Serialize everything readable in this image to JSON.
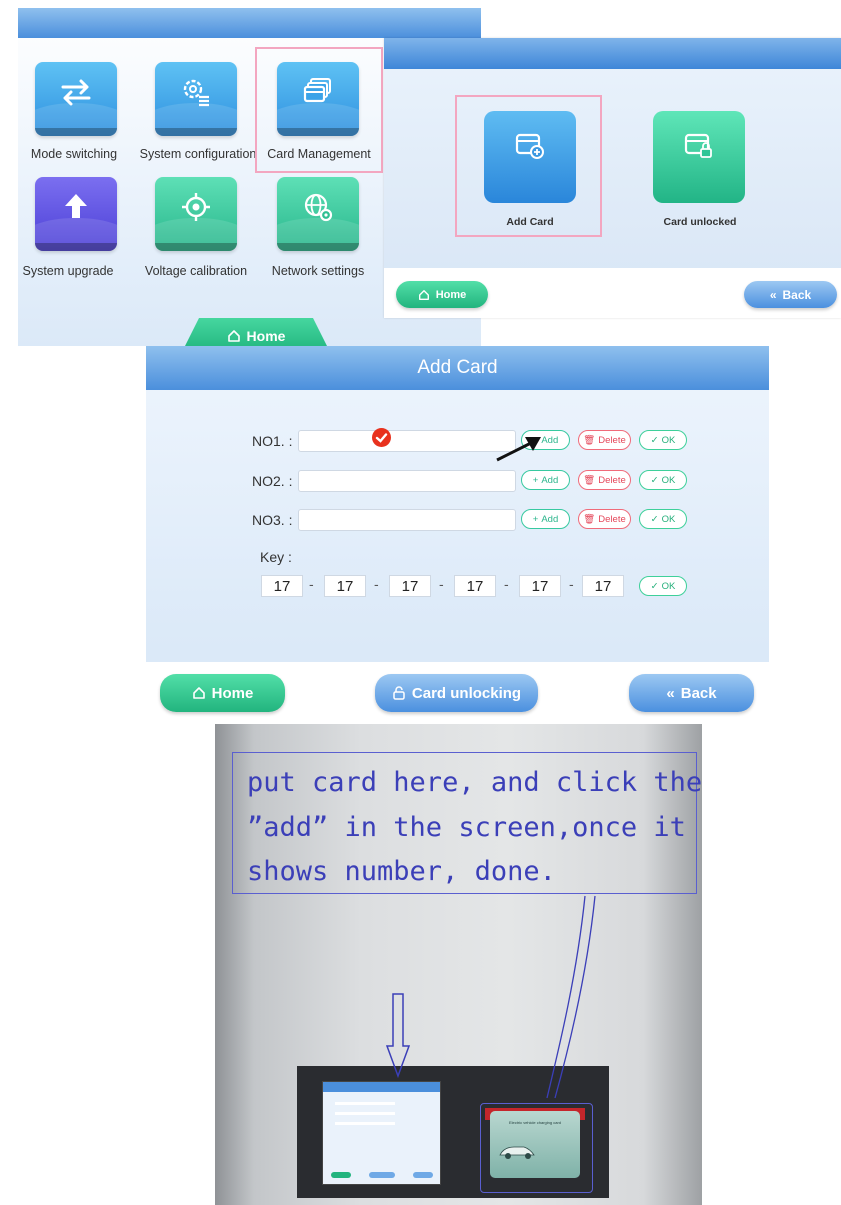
{
  "main_menu": {
    "tiles": [
      {
        "label": "Mode switching",
        "icon": "swap-arrows-icon"
      },
      {
        "label": "System configuration",
        "icon": "gear-list-icon"
      },
      {
        "label": "Card Management",
        "icon": "cards-icon"
      },
      {
        "label": "System upgrade",
        "icon": "upload-arrow-icon"
      },
      {
        "label": "Voltage calibration",
        "icon": "target-icon"
      },
      {
        "label": "Network settings",
        "icon": "globe-gear-icon"
      }
    ],
    "home_label": "Home"
  },
  "card_management": {
    "tiles": [
      {
        "label": "Add Card",
        "icon": "card-add-icon"
      },
      {
        "label": "Card unlocked",
        "icon": "card-lock-icon"
      }
    ],
    "home_label": "Home",
    "back_label": "Back"
  },
  "add_card": {
    "title": "Add Card",
    "rows": [
      {
        "label": "NO1. :",
        "value": ""
      },
      {
        "label": "NO2. :",
        "value": ""
      },
      {
        "label": "NO3. :",
        "value": ""
      }
    ],
    "add_label": "Add",
    "delete_label": "Delete",
    "ok_label": "OK",
    "key_label": "Key :",
    "key_values": [
      "17",
      "17",
      "17",
      "17",
      "17",
      "17"
    ],
    "home_label": "Home",
    "unlock_label": "Card unlocking",
    "back_label": "Back"
  },
  "photo": {
    "note_lines": [
      "put card here, and click the",
      "”add” in the screen,once it",
      "shows number, done."
    ],
    "card_text": "Electric vehicle charging card"
  },
  "colors": {
    "header_blue": "#4b8fdc",
    "home_green": "#22b47e",
    "highlight_pink": "#f3a6c0",
    "annotation_blue": "#3b3fb8"
  }
}
